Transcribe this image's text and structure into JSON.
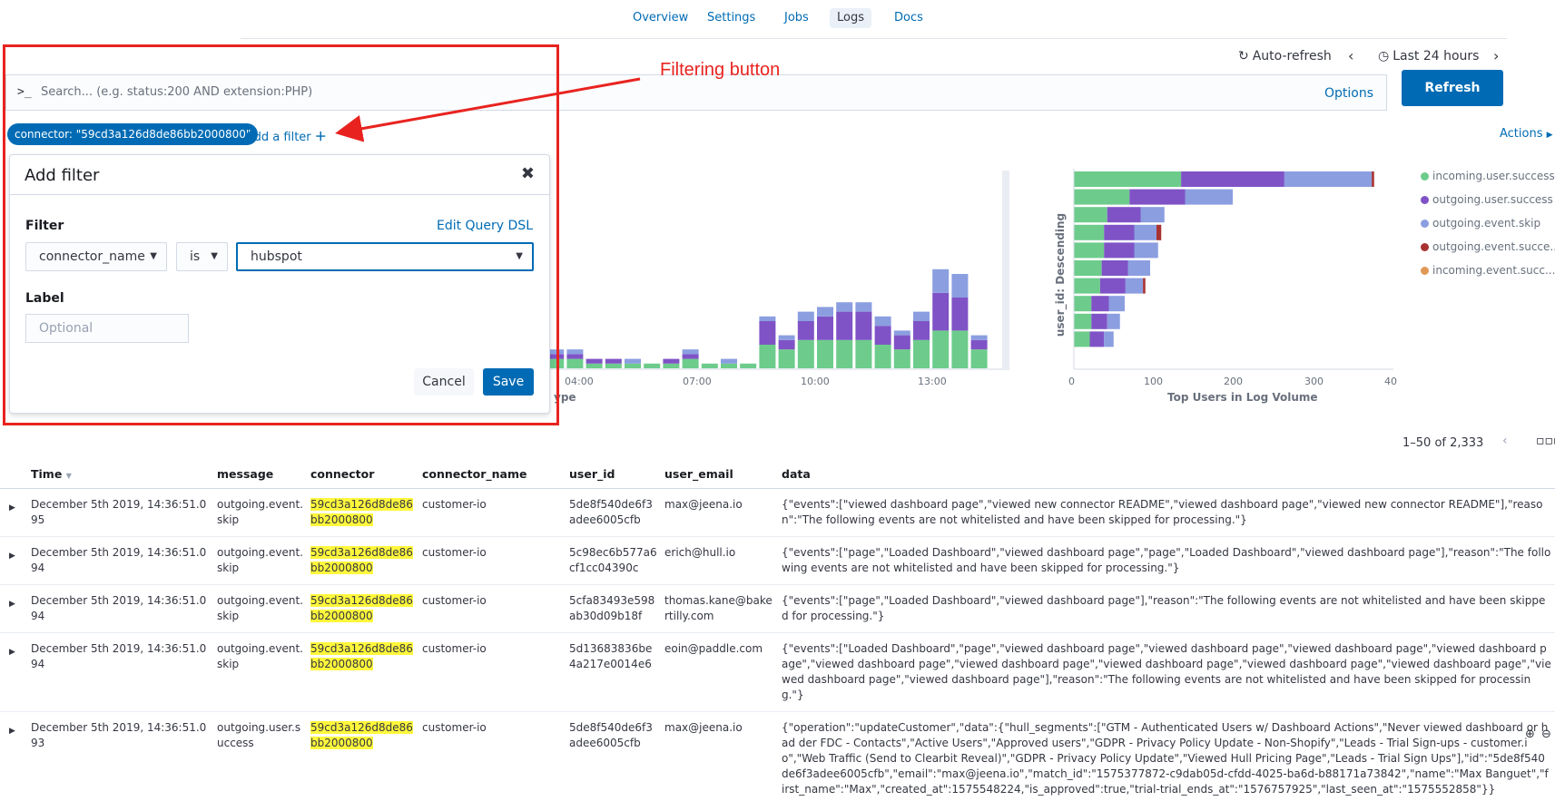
{
  "nav": {
    "tabs": [
      "Overview",
      "Settings",
      "Jobs",
      "Logs",
      "Docs"
    ],
    "active": "Logs"
  },
  "time": {
    "auto_refresh": "Auto-refresh",
    "range": "Last 24 hours",
    "refresh_label": "Refresh"
  },
  "search": {
    "prompt": ">_",
    "placeholder": "Search... (e.g. status:200 AND extension:PHP)",
    "options_label": "Options"
  },
  "filters": {
    "pill": "connector: \"59cd3a126d8de86bb2000800\"",
    "add_filter": "Add a filter",
    "actions": "Actions"
  },
  "popover": {
    "title": "Add filter",
    "filter_label": "Filter",
    "edit_dsl": "Edit Query DSL",
    "field": "connector_name",
    "operator": "is",
    "value": "hubspot",
    "label_label": "Label",
    "label_placeholder": "Optional",
    "cancel": "Cancel",
    "save": "Save"
  },
  "annotation": {
    "text": "Filtering button"
  },
  "colors": {
    "success_in": "#6dcc8b",
    "success_out": "#7f53c6",
    "skip": "#8b9ee0",
    "succ_out_event": "#a83232",
    "succ_in_event": "#e09856"
  },
  "chart_data": [
    {
      "type": "bar",
      "stacked": true,
      "xlabel": "ype",
      "tick_labels": [
        "04:00",
        "07:00",
        "10:00",
        "13:00"
      ],
      "series": [
        {
          "name": "incoming.user.success",
          "values": [
            1,
            2,
            2,
            1,
            1,
            1,
            1,
            1,
            2,
            1,
            1,
            1,
            5,
            4,
            6,
            6,
            6,
            6,
            5,
            4,
            6,
            8,
            8,
            4
          ]
        },
        {
          "name": "outgoing.user.success",
          "values": [
            1,
            1,
            1,
            1,
            1,
            0,
            0,
            1,
            1,
            0,
            0,
            0,
            5,
            2,
            4,
            5,
            6,
            6,
            4,
            3,
            4,
            8,
            7,
            2
          ]
        },
        {
          "name": "outgoing.event.skip",
          "values": [
            0,
            1,
            1,
            0,
            0,
            1,
            0,
            0,
            1,
            0,
            1,
            0,
            1,
            1,
            2,
            2,
            2,
            2,
            2,
            1,
            2,
            5,
            5,
            1
          ]
        }
      ]
    },
    {
      "type": "bar",
      "orientation": "horizontal",
      "stacked": true,
      "title": "Top Users in Log Volume",
      "ylabel": "user_id: Descending",
      "tick_labels": [
        "0",
        "100",
        "200",
        "300",
        "40"
      ],
      "xlim": [
        0,
        400
      ],
      "series": [
        {
          "name": "incoming.user.success",
          "values": [
            135,
            70,
            42,
            38,
            38,
            35,
            33,
            22,
            22,
            20
          ]
        },
        {
          "name": "outgoing.user.success",
          "values": [
            130,
            70,
            42,
            38,
            38,
            33,
            32,
            22,
            20,
            18
          ]
        },
        {
          "name": "outgoing.event.skip",
          "values": [
            110,
            60,
            30,
            28,
            30,
            28,
            22,
            20,
            16,
            12
          ]
        },
        {
          "name": "outgoing.event.success",
          "values": [
            3,
            0,
            0,
            6,
            0,
            0,
            3,
            0,
            0,
            0
          ]
        }
      ]
    }
  ],
  "legend": [
    {
      "label": "incoming.user.success",
      "color": "#6dcc8b"
    },
    {
      "label": "outgoing.user.success",
      "color": "#7f53c6"
    },
    {
      "label": "outgoing.event.skip",
      "color": "#8b9ee0"
    },
    {
      "label": "outgoing.event.succe...",
      "color": "#a83232"
    },
    {
      "label": "incoming.event.succ...",
      "color": "#e09856"
    }
  ],
  "pagination": {
    "text": "1–50 of 2,333"
  },
  "table": {
    "columns": [
      "Time",
      "message",
      "connector",
      "connector_name",
      "user_id",
      "user_email",
      "data"
    ],
    "rows": [
      {
        "time": "December 5th 2019, 14:36:51.095",
        "message": "outgoing.event.skip",
        "connector": "59cd3a126d8de86bb2000800",
        "connector_name": "customer-io",
        "user_id": "5de8f540de6f3adee6005cfb",
        "user_email": "max@jeena.io",
        "data": "{\"events\":[\"viewed dashboard page\",\"viewed new connector README\",\"viewed dashboard page\",\"viewed new connector README\"],\"reason\":\"The following events are not whitelisted and have been skipped for processing.\"}"
      },
      {
        "time": "December 5th 2019, 14:36:51.094",
        "message": "outgoing.event.skip",
        "connector": "59cd3a126d8de86bb2000800",
        "connector_name": "customer-io",
        "user_id": "5c98ec6b577a6cf1cc04390c",
        "user_email": "erich@hull.io",
        "data": "{\"events\":[\"page\",\"Loaded Dashboard\",\"viewed dashboard page\",\"page\",\"Loaded Dashboard\",\"viewed dashboard page\"],\"reason\":\"The following events are not whitelisted and have been skipped for processing.\"}"
      },
      {
        "time": "December 5th 2019, 14:36:51.094",
        "message": "outgoing.event.skip",
        "connector": "59cd3a126d8de86bb2000800",
        "connector_name": "customer-io",
        "user_id": "5cfa83493e598ab30d09b18f",
        "user_email": "thomas.kane@bakertilly.com",
        "data": "{\"events\":[\"page\",\"Loaded Dashboard\",\"viewed dashboard page\"],\"reason\":\"The following events are not whitelisted and have been skipped for processing.\"}"
      },
      {
        "time": "December 5th 2019, 14:36:51.094",
        "message": "outgoing.event.skip",
        "connector": "59cd3a126d8de86bb2000800",
        "connector_name": "customer-io",
        "user_id": "5d13683836be4a217e0014e6",
        "user_email": "eoin@paddle.com",
        "data": "{\"events\":[\"Loaded Dashboard\",\"page\",\"viewed dashboard page\",\"viewed dashboard page\",\"viewed dashboard page\",\"viewed dashboard page\",\"viewed dashboard page\",\"viewed dashboard page\",\"viewed dashboard page\",\"viewed dashboard page\",\"viewed dashboard page\",\"viewed dashboard page\",\"viewed dashboard page\"],\"reason\":\"The following events are not whitelisted and have been skipped for processing.\"}"
      },
      {
        "time": "December 5th 2019, 14:36:51.093",
        "message": "outgoing.user.success",
        "connector": "59cd3a126d8de86bb2000800",
        "connector_name": "customer-io",
        "user_id": "5de8f540de6f3adee6005cfb",
        "user_email": "max@jeena.io",
        "data": "{\"operation\":\"updateCustomer\",\"data\":{\"hull_segments\":[\"GTM - Authenticated Users w/ Dashboard Actions\",\"Never viewed dashboard or had der FDC - Contacts\",\"Active Users\",\"Approved users\",\"GDPR - Privacy Policy Update - Non-Shopify\",\"Leads - Trial Sign-ups - customer.io\",\"Web Traffic (Send to Clearbit Reveal)\",\"GDPR - Privacy Policy Update\",\"Viewed Hull Pricing Page\",\"Leads - Trial Sign Ups\"],\"id\":\"5de8f540de6f3adee6005cfb\",\"email\":\"max@jeena.io\",\"match_id\":\"1575377872-c9dab05d-cfdd-4025-ba6d-b88171a73842\",\"name\":\"Max Banguet\",\"first_name\":\"Max\",\"created_at\":1575548224,\"is_approved\":true,\"trial-trial_ends_at\":\"1576757925\",\"last_seen_at\":\"1575552858\"}}"
      }
    ]
  }
}
